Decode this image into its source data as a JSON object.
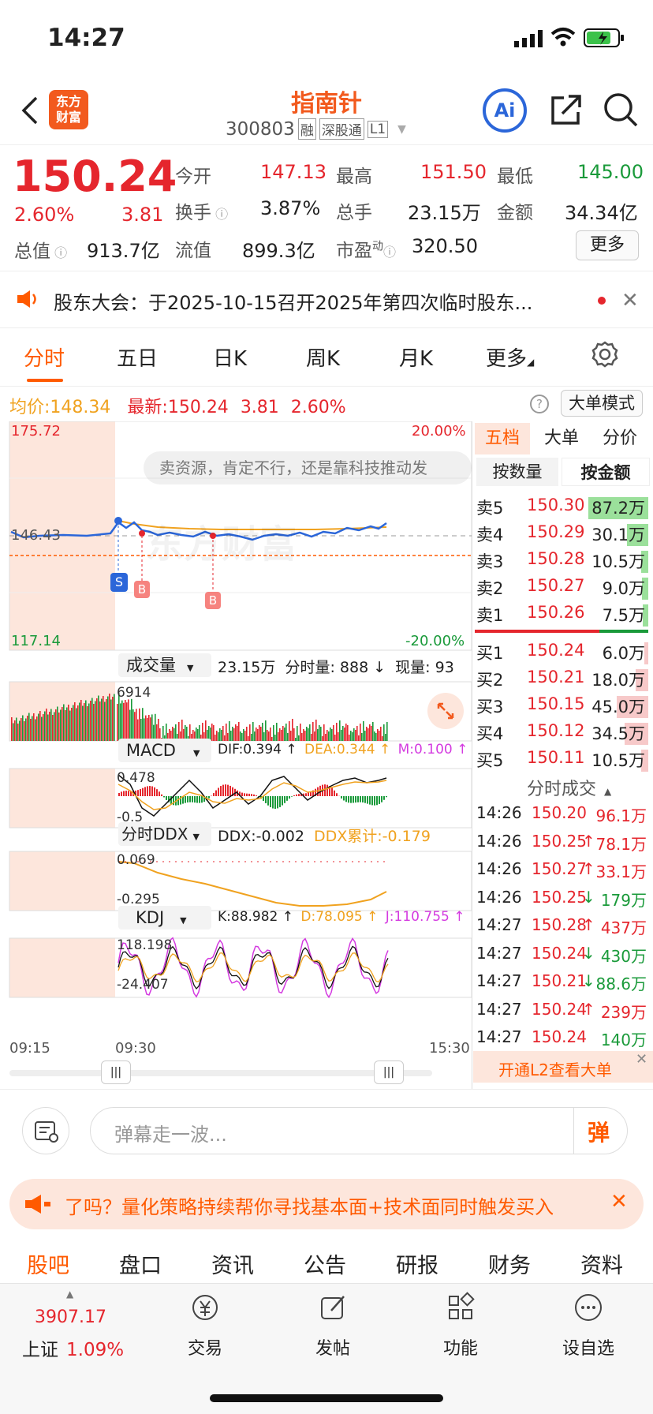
{
  "status": {
    "time": "14:27"
  },
  "header": {
    "name": "指南针",
    "code": "300803",
    "tags": [
      "融",
      "深股通",
      "L1"
    ],
    "ai_label": "Ai",
    "logo_lines": [
      "东方",
      "财富"
    ]
  },
  "quote": {
    "price": "150.24",
    "pct": "2.60%",
    "chg": "3.81",
    "open_l": "今开",
    "open_v": "147.13",
    "high_l": "最高",
    "high_v": "151.50",
    "low_l": "最低",
    "low_v": "145.00",
    "turn_l": "换手",
    "turn_v": "3.87%",
    "vol_l": "总手",
    "vol_v": "23.15万",
    "amt_l": "金额",
    "amt_v": "34.34亿",
    "mcap_l": "总值",
    "mcap_v": "913.7亿",
    "flt_l": "流值",
    "flt_v": "899.3亿",
    "pe_l": "市盈",
    "pe_sup": "动",
    "pe_v": "320.50",
    "more": "更多"
  },
  "notice": {
    "text": "股东大会：于2025-10-15召开2025年第四次临时股东..."
  },
  "tabs": [
    "分时",
    "五日",
    "日K",
    "周K",
    "月K",
    "更多"
  ],
  "info": {
    "avg_l": "均价:",
    "avg_v": "148.34",
    "last_l": "最新:",
    "last_v": "150.24",
    "chg": "3.81",
    "pct": "2.60%",
    "mode": "大单模式"
  },
  "price_chart": {
    "hi": "175.72",
    "mid": "146.43",
    "lo": "117.14",
    "pct_hi": "20.00%",
    "pct_lo": "-20.00%",
    "bubble": "卖资源，肯定不行，还是靠科技推动发",
    "watermark": "东方财富",
    "markers": [
      "S",
      "B",
      "B"
    ]
  },
  "vol_panel": {
    "title": "成交量",
    "info1": "23.15万",
    "info2": "分时量: 888 ↓",
    "info3": "现量: 93",
    "max": "6914"
  },
  "macd_panel": {
    "title": "MACD",
    "dif": "DIF:0.394 ↑",
    "dea": "DEA:0.344 ↑",
    "m": "M:0.100 ↑",
    "hi": "0.478",
    "lo": "-0.5"
  },
  "ddx_panel": {
    "title": "分时DDX",
    "ddx": "DDX:-0.002",
    "acc": "DDX累计:-0.179",
    "hi": "0.069",
    "lo": "-0.295"
  },
  "kdj_panel": {
    "title": "KDJ",
    "k": "K:88.982 ↑",
    "d": "D:78.095 ↑",
    "j": "J:110.755 ↑",
    "hi": "118.198",
    "lo": "-24.407"
  },
  "time_axis": [
    "09:15",
    "09:30",
    "15:30"
  ],
  "orderbook": {
    "tabs": [
      "五档",
      "大单",
      "分价"
    ],
    "subtabs": [
      "按数量",
      "按金额"
    ],
    "asks": [
      [
        "卖5",
        "150.30",
        "87.2万"
      ],
      [
        "卖4",
        "150.29",
        "30.1万"
      ],
      [
        "卖3",
        "150.28",
        "10.5万"
      ],
      [
        "卖2",
        "150.27",
        "9.0万"
      ],
      [
        "卖1",
        "150.26",
        "7.5万"
      ]
    ],
    "bids": [
      [
        "买1",
        "150.24",
        "6.0万"
      ],
      [
        "买2",
        "150.21",
        "18.0万"
      ],
      [
        "买3",
        "150.15",
        "45.0万"
      ],
      [
        "买4",
        "150.12",
        "34.5万"
      ],
      [
        "买5",
        "150.11",
        "10.5万"
      ]
    ],
    "ask_fill": [
      1.0,
      0.35,
      0.12,
      0.1,
      0.09
    ],
    "bid_fill": [
      0.07,
      0.21,
      0.52,
      0.4,
      0.12
    ]
  },
  "trades": {
    "title": "分时成交",
    "rows": [
      [
        "14:26",
        "150.20",
        "",
        "96.1万",
        "red",
        "red"
      ],
      [
        "14:26",
        "150.25",
        "↑",
        "78.1万",
        "red",
        "red"
      ],
      [
        "14:26",
        "150.27",
        "↑",
        "33.1万",
        "red",
        "red"
      ],
      [
        "14:26",
        "150.25",
        "↓",
        "179万",
        "red",
        "green"
      ],
      [
        "14:27",
        "150.28",
        "↑",
        "437万",
        "red",
        "red"
      ],
      [
        "14:27",
        "150.24",
        "↓",
        "430万",
        "red",
        "green"
      ],
      [
        "14:27",
        "150.21",
        "↓",
        "88.6万",
        "red",
        "green"
      ],
      [
        "14:27",
        "150.24",
        "↑",
        "239万",
        "red",
        "red"
      ],
      [
        "14:27",
        "150.24",
        "",
        "140万",
        "red",
        "green"
      ]
    ],
    "l2": "开通L2查看大单"
  },
  "comment": {
    "placeholder": "弹幕走一波...",
    "send": "弹"
  },
  "promo": {
    "text": "了吗？量化策略持续帮你寻找基本面+技术面同时触发买入"
  },
  "bottom_tabs": [
    "股吧",
    "盘口",
    "资讯",
    "公告",
    "研报",
    "财务",
    "资料"
  ],
  "nav": {
    "index_v": "3907.17",
    "index_l": "上证",
    "index_pct": "1.09%",
    "items": [
      "交易",
      "发帖",
      "功能",
      "设自选"
    ]
  },
  "colors": {
    "red": "#e5262d",
    "green": "#1a9a3a",
    "orange": "#ff5a00",
    "accent": "#2b66d9"
  }
}
